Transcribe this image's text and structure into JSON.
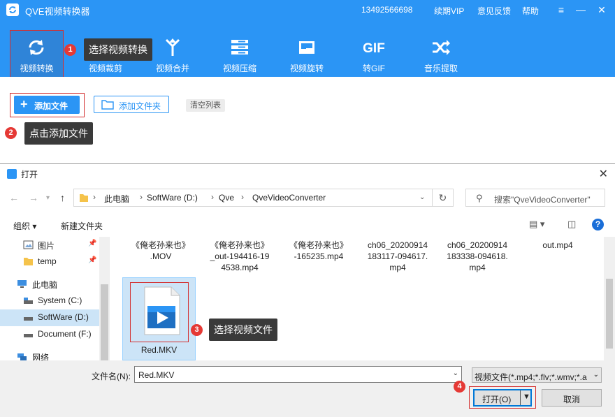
{
  "app": {
    "title": "QVE视频转换器",
    "phone": "13492566698",
    "vip": "续期VIP",
    "feedback": "意见反馈",
    "help": "帮助"
  },
  "tools": [
    {
      "label": "视频转换",
      "icon": "convert-icon"
    },
    {
      "label": "视频裁剪",
      "icon": "scissors-icon"
    },
    {
      "label": "视频合并",
      "icon": "merge-icon"
    },
    {
      "label": "视频压缩",
      "icon": "compress-icon"
    },
    {
      "label": "视频旋转",
      "icon": "rotate-icon"
    },
    {
      "label": "转GIF",
      "icon": "gif-icon",
      "icon_text": "GIF"
    },
    {
      "label": "音乐提取",
      "icon": "shuffle-icon"
    }
  ],
  "callouts": {
    "c1": {
      "num": "1",
      "text": "选择视频转换"
    },
    "c2": {
      "num": "2",
      "text": "点击添加文件"
    },
    "c3": {
      "num": "3",
      "text": "选择视频文件"
    },
    "c4": {
      "num": "4"
    }
  },
  "actions": {
    "add_file": "添加文件",
    "add_folder": "添加文件夹",
    "clear_list": "清空列表"
  },
  "dialog": {
    "title": "打开",
    "breadcrumb": [
      "此电脑",
      "SoftWare (D:)",
      "Qve",
      "QveVideoConverter"
    ],
    "search_placeholder": "搜索\"QveVideoConverter\"",
    "organize": "组织 ▾",
    "new_folder": "新建文件夹",
    "sidebar": [
      {
        "label": "图片",
        "icon": "pictures-icon",
        "pinned": true
      },
      {
        "label": "temp",
        "icon": "folder-icon",
        "pinned": true
      },
      {
        "label": "此电脑",
        "icon": "computer-icon",
        "pinned": false
      },
      {
        "label": "System (C:)",
        "icon": "drive-icon",
        "pinned": false
      },
      {
        "label": "SoftWare (D:)",
        "icon": "drive-icon",
        "pinned": false,
        "selected": true
      },
      {
        "label": "Document (F:)",
        "icon": "drive-icon",
        "pinned": false
      },
      {
        "label": "网络",
        "icon": "network-icon",
        "pinned": false
      }
    ],
    "files": [
      {
        "lines": [
          "《俺老孙来也》",
          ".MOV"
        ]
      },
      {
        "lines": [
          "《俺老孙来也》",
          "_out-194416-19",
          "4538.mp4"
        ]
      },
      {
        "lines": [
          "《俺老孙来也》",
          "-165235.mp4"
        ]
      },
      {
        "lines": [
          "ch06_20200914",
          "183117-094617.",
          "mp4"
        ]
      },
      {
        "lines": [
          "ch06_20200914",
          "183338-094618.",
          "mp4"
        ]
      },
      {
        "lines": [
          "out.mp4"
        ]
      },
      {
        "lines": [
          "Red.MKV"
        ],
        "selected": true
      }
    ],
    "filename_label": "文件名(N):",
    "filename_value": "Red.MKV",
    "filetype": "视频文件(*.mp4;*.flv;*.wmv;*.a",
    "open_button": "打开(O)",
    "cancel_button": "取消"
  }
}
